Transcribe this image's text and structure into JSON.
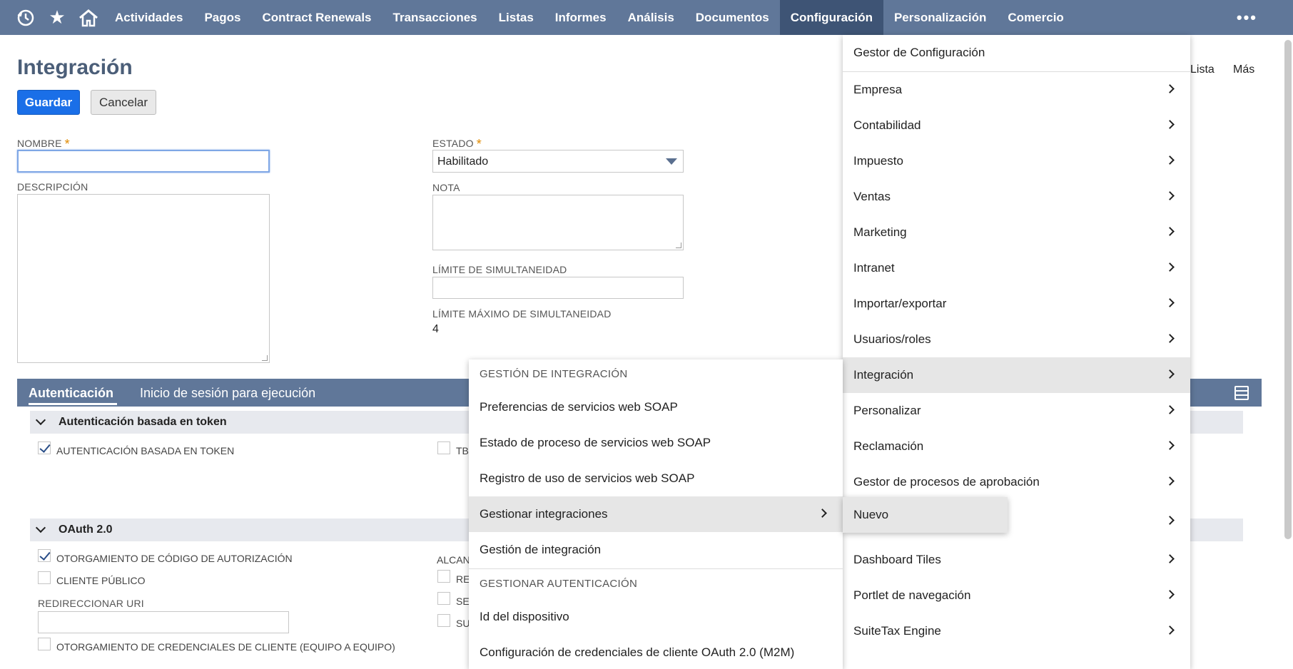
{
  "nav": {
    "items": [
      "Actividades",
      "Pagos",
      "Contract Renewals",
      "Transacciones",
      "Listas",
      "Informes",
      "Análisis",
      "Documentos",
      "Configuración",
      "Personalización",
      "Comercio"
    ],
    "active": "Configuración",
    "more": "•••"
  },
  "header": {
    "title": "Integración",
    "save": "Guardar",
    "cancel": "Cancelar",
    "links": [
      "Lista",
      "Más"
    ]
  },
  "form": {
    "nombre_label": "NOMBRE",
    "nombre_value": "",
    "descripcion_label": "DESCRIPCIÓN",
    "estado_label": "ESTADO",
    "estado_value": "Habilitado",
    "nota_label": "NOTA",
    "limite_label": "LÍMITE DE SIMULTANEIDAD",
    "limite_max_label": "LÍMITE MÁXIMO DE SIMULTANEIDAD",
    "limite_max_value": "4",
    "required_mark": "*"
  },
  "subtabs": {
    "active": "Autenticación",
    "second": "Inicio de sesión para ejecución"
  },
  "sections": {
    "token": {
      "title": "Autenticación basada en token",
      "cb1": "AUTENTICACIÓN BASADA EN TOKEN",
      "cb2_partial": "TB"
    },
    "oauth": {
      "title": "OAuth 2.0",
      "cb_code": "OTORGAMIENTO DE CÓDIGO DE AUTORIZACIÓN",
      "cb_public": "CLIENTE PÚBLICO",
      "redirect_label": "REDIRECCIONAR URI",
      "cb_client_cred": "OTORGAMIENTO DE CREDENCIALES DE CLIENTE (EQUIPO A EQUIPO)",
      "scope_partial": "ALCAN",
      "scope_items": [
        "RE",
        "SE",
        "SU"
      ]
    }
  },
  "config_menu": {
    "top": "Gestor de Configuración",
    "items": [
      "Empresa",
      "Contabilidad",
      "Impuesto",
      "Ventas",
      "Marketing",
      "Intranet",
      "Importar/exportar",
      "Usuarios/roles",
      "Integración",
      "Personalizar",
      "Reclamación",
      "Gestor de procesos de aprobación",
      "",
      "Dashboard Tiles",
      "Portlet de navegación",
      "SuiteTax Engine"
    ],
    "highlighted": "Integración"
  },
  "integration_menu": {
    "header1": "GESTIÓN DE INTEGRACIÓN",
    "items1": [
      "Preferencias de servicios web SOAP",
      "Estado de proceso de servicios web SOAP",
      "Registro de uso de servicios web SOAP",
      "Gestionar integraciones",
      "Gestión de integración"
    ],
    "highlighted": "Gestionar integraciones",
    "header2": "GESTIONAR AUTENTICACIÓN",
    "items2": [
      "Id del dispositivo",
      "Configuración de credenciales de cliente OAuth 2.0 (M2M)"
    ]
  },
  "nuevo_menu": {
    "item": "Nuevo"
  }
}
